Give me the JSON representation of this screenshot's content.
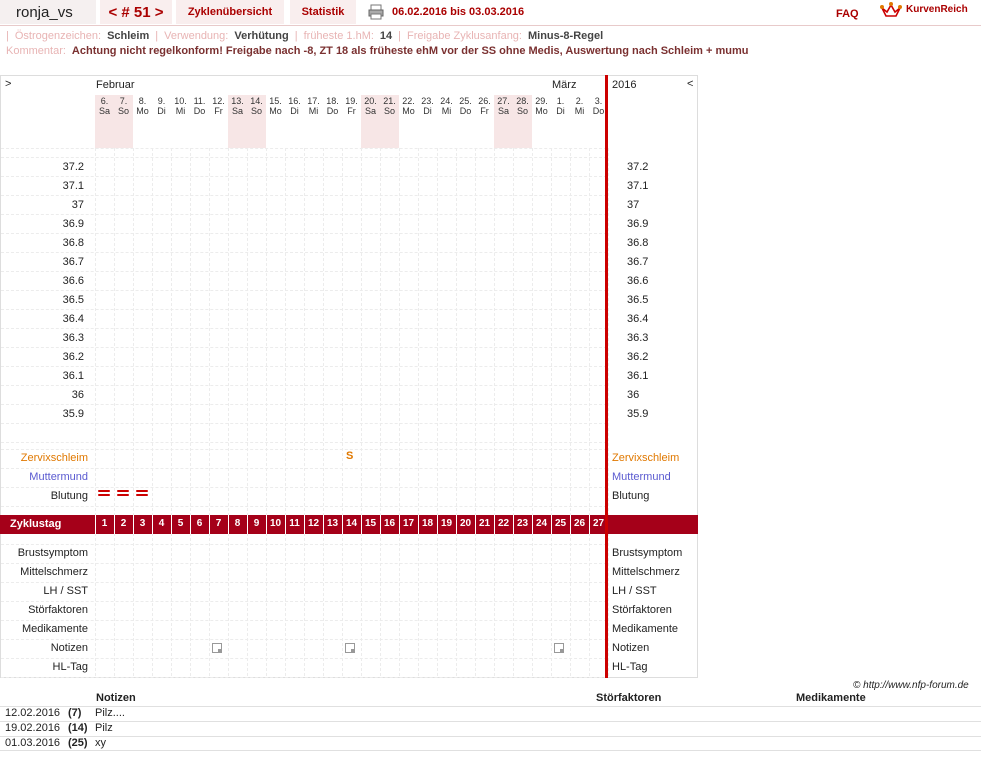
{
  "header": {
    "username": "ronja_vs",
    "cycle": "< # 51 >",
    "tabs": [
      "Zyklenübersicht",
      "Statistik"
    ],
    "date_range": "06.02.2016 bis 03.03.2016",
    "faq": "FAQ",
    "logo": "KurvenReich"
  },
  "info": {
    "oestrogen_label": "Östrogenzeichen:",
    "oestrogen_value": "Schleim",
    "usage_label": "Verwendung:",
    "usage_value": "Verhütung",
    "earliest_label": "früheste 1.hM:",
    "earliest_value": "14",
    "release_label": "Freigabe Zyklusanfang:",
    "release_value": "Minus-8-Regel",
    "comment_label": "Kommentar:",
    "comment_value": "Achtung nicht regelkonform! Freigabe nach -8, ZT 18 als früheste ehM vor der SS ohne Medis, Auswertung nach Schleim + mumu"
  },
  "chart": {
    "nav_left": ">",
    "nav_right": "<",
    "month1": "Februar",
    "month2": "März",
    "year": "2016",
    "days": [
      {
        "d": "6.",
        "w": "Sa"
      },
      {
        "d": "7.",
        "w": "So"
      },
      {
        "d": "8.",
        "w": "Mo"
      },
      {
        "d": "9.",
        "w": "Di"
      },
      {
        "d": "10.",
        "w": "Mi"
      },
      {
        "d": "11.",
        "w": "Do"
      },
      {
        "d": "12.",
        "w": "Fr"
      },
      {
        "d": "13.",
        "w": "Sa"
      },
      {
        "d": "14.",
        "w": "So"
      },
      {
        "d": "15.",
        "w": "Mo"
      },
      {
        "d": "16.",
        "w": "Di"
      },
      {
        "d": "17.",
        "w": "Mi"
      },
      {
        "d": "18.",
        "w": "Do"
      },
      {
        "d": "19.",
        "w": "Fr"
      },
      {
        "d": "20.",
        "w": "Sa"
      },
      {
        "d": "21.",
        "w": "So"
      },
      {
        "d": "22.",
        "w": "Mo"
      },
      {
        "d": "23.",
        "w": "Di"
      },
      {
        "d": "24.",
        "w": "Mi"
      },
      {
        "d": "25.",
        "w": "Do"
      },
      {
        "d": "26.",
        "w": "Fr"
      },
      {
        "d": "27.",
        "w": "Sa"
      },
      {
        "d": "28.",
        "w": "So"
      },
      {
        "d": "29.",
        "w": "Mo"
      },
      {
        "d": "1.",
        "w": "Di"
      },
      {
        "d": "2.",
        "w": "Mi"
      },
      {
        "d": "3.",
        "w": "Do"
      }
    ],
    "temps": [
      "37.2",
      "37.1",
      "37",
      "36.9",
      "36.8",
      "36.7",
      "36.6",
      "36.5",
      "36.4",
      "36.3",
      "36.2",
      "36.1",
      "36",
      "35.9"
    ],
    "rows_top": [
      {
        "label": "Zervixschleim",
        "color": "#e07800"
      },
      {
        "label": "Muttermund",
        "color": "#5a5ad0"
      },
      {
        "label": "Blutung",
        "color": "#222"
      }
    ],
    "cycle_label": "Zyklustag",
    "rows_bottom": [
      "Brustsymptom",
      "Mittelschmerz",
      "LH / SST",
      "Störfaktoren",
      "Medikamente",
      "Notizen",
      "HL-Tag"
    ],
    "mucus_symbol": "S",
    "copyright": "© http://www.nfp-forum.de"
  },
  "footer": {
    "headers": [
      "Notizen",
      "Störfaktoren",
      "Medikamente"
    ],
    "rows": [
      {
        "date": "12.02.2016",
        "day": "(7)",
        "note": "Pilz...."
      },
      {
        "date": "19.02.2016",
        "day": "(14)",
        "note": "Pilz"
      },
      {
        "date": "01.03.2016",
        "day": "(25)",
        "note": "xy"
      }
    ]
  }
}
